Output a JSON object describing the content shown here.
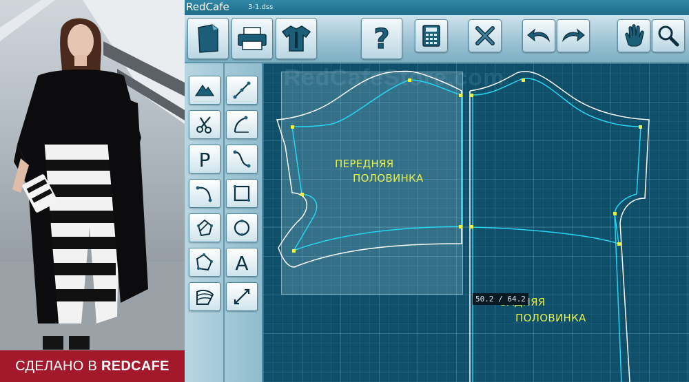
{
  "photo": {
    "banner_prefix": "СДЕЛАНО В ",
    "banner_brand": "REDCAFE"
  },
  "app": {
    "title": "RedCafe",
    "file_name": "3-1.dss"
  },
  "toolbar": {
    "buttons": [
      {
        "name": "new-document-button",
        "icon": "document-icon"
      },
      {
        "name": "print-button",
        "icon": "printer-icon"
      },
      {
        "name": "model-button",
        "icon": "tshirt-icon"
      },
      {
        "name": "help-button",
        "icon": "question-icon"
      },
      {
        "name": "calculator-button",
        "icon": "calculator-icon"
      },
      {
        "name": "delete-button",
        "icon": "close-x-icon"
      },
      {
        "name": "undo-button",
        "icon": "undo-arrow-icon"
      },
      {
        "name": "redo-button",
        "icon": "redo-arrow-icon"
      },
      {
        "name": "pan-button",
        "icon": "hand-icon"
      },
      {
        "name": "zoom-button",
        "icon": "magnifier-icon"
      }
    ]
  },
  "sidebar": {
    "tools": [
      "mountain-icon",
      "line-dots-icon",
      "scissors-icon",
      "curve-icon",
      "p-letter-icon",
      "s-curve-icon",
      "arc-icon",
      "square-icon",
      "rotate-shape-icon",
      "circle-icon",
      "polygon-icon",
      "a-letter-icon",
      "fan-icon",
      "measure-arrow-icon"
    ]
  },
  "canvas": {
    "watermark": "RedCafeStore.com",
    "front_label_line1": "ПЕРЕДНЯЯ",
    "front_label_line2": "ПОЛОВИНКА",
    "back_label_line1": "ЗАДНЯЯ",
    "back_label_line2": "ПОЛОВИНКА",
    "coordinates": "50.2 / 64.2"
  },
  "colors": {
    "outline": "#ffffff",
    "seam": "#27d6f2",
    "point": "#e8f04a",
    "label": "#e8f04a"
  }
}
